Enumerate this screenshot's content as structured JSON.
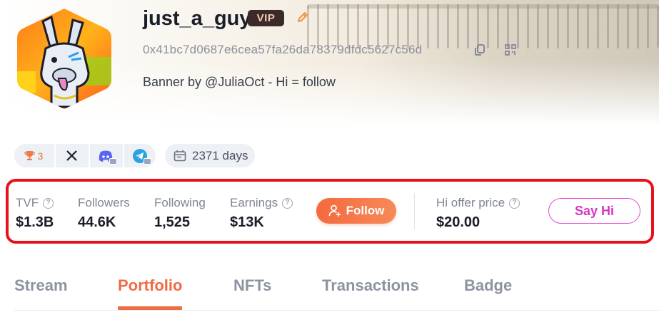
{
  "profile": {
    "username": "just_a_guy",
    "vip_label": "VIP",
    "address": "0x41bc7d0687e6cea57fa26da78379dfdc5627c56d",
    "bio": "Banner by @JuliaOct - Hi = follow",
    "avatar_icon": "llama-avatar-icon"
  },
  "social": {
    "trophy_count": "3",
    "days_label": "2371 days"
  },
  "stats": {
    "tvf_label": "TVF",
    "tvf_value": "$1.3B",
    "followers_label": "Followers",
    "followers_value": "44.6K",
    "following_label": "Following",
    "following_value": "1,525",
    "earnings_label": "Earnings",
    "earnings_value": "$13K",
    "follow_label": "Follow",
    "hi_price_label": "Hi offer price",
    "hi_price_value": "$20.00",
    "sayhi_label": "Say Hi"
  },
  "tabs": [
    {
      "label": "Stream"
    },
    {
      "label": "Portfolio",
      "active": true
    },
    {
      "label": "NFTs"
    },
    {
      "label": "Transactions"
    },
    {
      "label": "Badge"
    }
  ],
  "colors": {
    "accent": "#f06a43",
    "highlight_border": "#e8111b",
    "sayhi": "#d536c4",
    "vip_bg": "#3b2a2a"
  }
}
